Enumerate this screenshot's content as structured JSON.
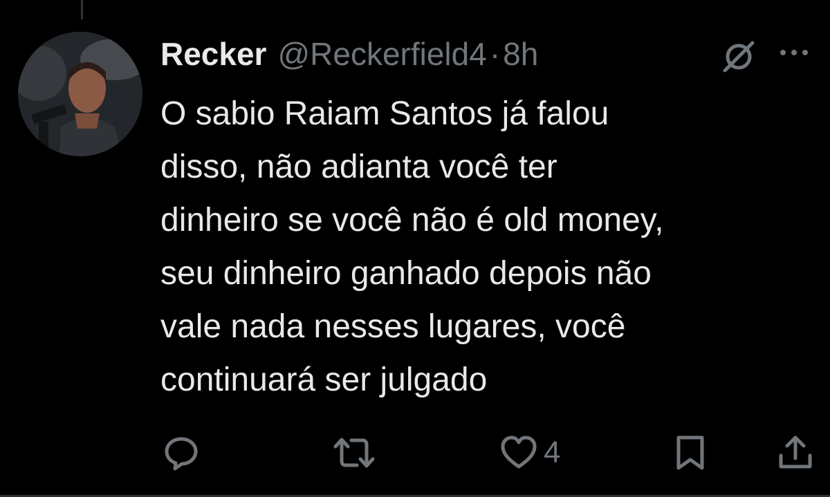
{
  "tweet": {
    "author_name": "Recker",
    "author_handle": "@Reckerfield4",
    "separator": "·",
    "time": "8h",
    "text_lines": [
      "O sabio Raiam Santos já falou",
      "disso, não adianta você ter",
      "dinheiro se você não é old money,",
      "seu dinheiro ganhado depois não",
      "vale nada nesses lugares, você",
      "continuará ser julgado"
    ]
  },
  "actions": {
    "reply_icon": "reply-icon",
    "retweet_icon": "retweet-icon",
    "like_icon": "heart-icon",
    "like_count": "4",
    "bookmark_icon": "bookmark-icon",
    "share_icon": "share-icon"
  },
  "colors": {
    "background": "#000000",
    "text_primary": "#e7e9ea",
    "text_secondary": "#71767b"
  }
}
